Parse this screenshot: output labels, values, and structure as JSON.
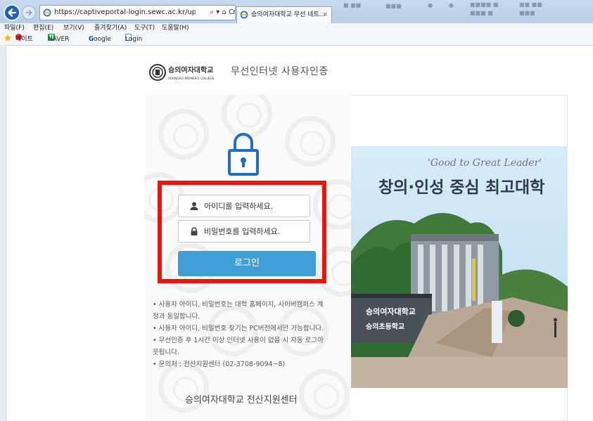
{
  "browser": {
    "url": "https://captiveportal-login.sewc.ac.kr/upload/custon",
    "address_tools": "⌕ ▾ ⌂ C",
    "tab_title": "승의여자대학교 무선 네트...",
    "tab_close": "×",
    "menu": [
      "파일(F)",
      "편집(E)",
      "보기(V)",
      "즐겨찾기(A)",
      "도구(T)",
      "도움말(H)"
    ],
    "favorites": [
      "네이트",
      "NAVER",
      "Google",
      "Login"
    ]
  },
  "portal": {
    "logo_name": "승의여자대학교",
    "logo_sub": "SOONGEUI WOMEN'S COLLEGE",
    "header_title": "무선인터넷 사용자인증",
    "id_placeholder": "아이디를 입력하세요.",
    "pw_placeholder": "비밀번호를 입력하세요.",
    "login_label": "로그인",
    "notes": [
      "•  사용자 아이디, 비밀번호는 대학 홈페이지, 사이버캠퍼스 계",
      "정과 동일합니다.",
      "•  사용자 아이디, 비밀번호 찾기는 PC버전에서만 가능합니다.",
      "•  무선인증 후 1시간 이상 인터넷 사용이 없을 시 자동 로그아",
      "웃됩니다.",
      "•  문의처 : 전산지원센터 (02-3708-9094~8)"
    ],
    "footer": "승의여자대학교 전산지원센터",
    "slogan_en": "'Good to Great Leader'",
    "slogan_ko": "창의·인성 중심 최고대학",
    "campus_sign1": "승의여자대학교",
    "campus_sign2": "승의초등학교"
  },
  "colors": {
    "login_button": "#3fa0d7",
    "highlight_box": "#e8150b",
    "lock_icon": "#1e6fc4",
    "ie_back_button": "#1f5fb8"
  }
}
